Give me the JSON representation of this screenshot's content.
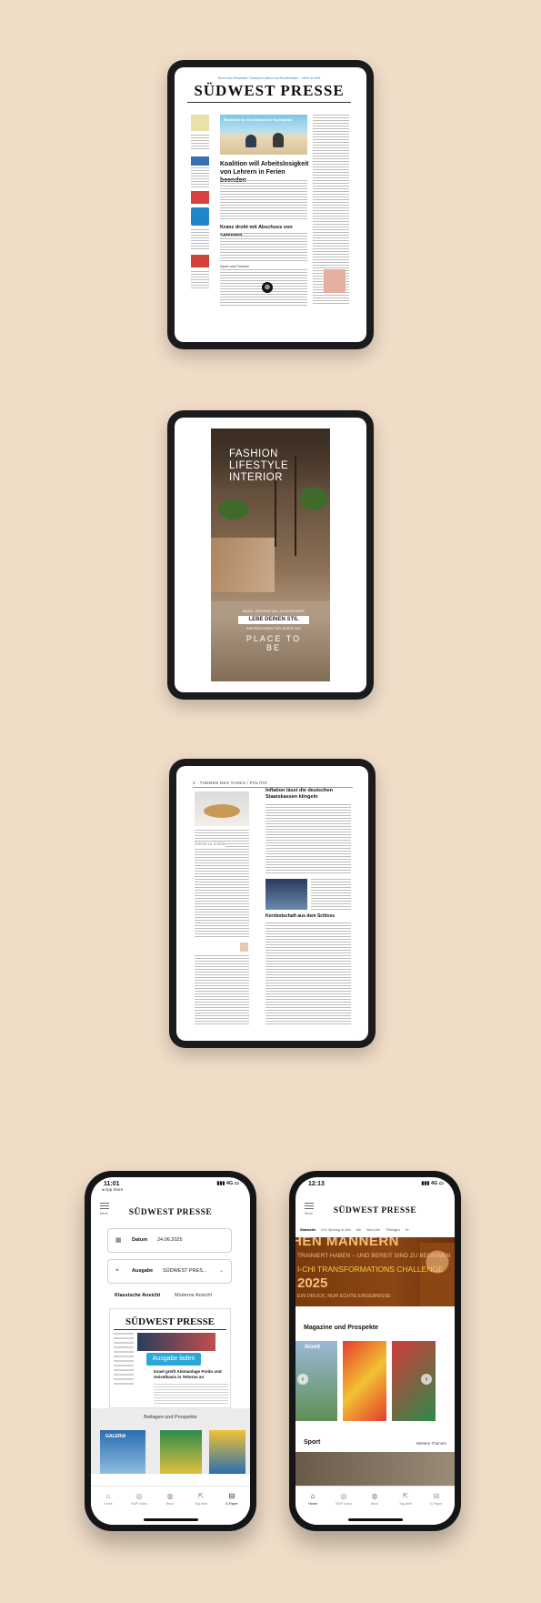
{
  "tablet1": {
    "top_line": "Rund ums Einkaufen: Gutschein-Aktion auf Sonderseiten – Mehr im Heft",
    "masthead": "SÜDWEST PRESSE",
    "photo_caption": "Rückkehr an den Strand der Normandie",
    "headline1": "Koalition will Arbeitslosigkeit von Lehrern in Ferien beenden",
    "headline2": "Kranz droht mit Abschuss von Satelliten",
    "section_label": "Sport und Freizeit"
  },
  "tablet2": {
    "title_lines": [
      "FASHION",
      "LIFESTYLE",
      "INTERIOR"
    ],
    "sub_line1": "MODE, DEKORATION, ACCESSOIRES",
    "boxed": "LEBE DEINEN STIL",
    "sub_line2": "INSPIRATIONEN FÜR JEDEN TAG",
    "place": "PLACE TO BE"
  },
  "tablet3": {
    "header": "2 · THEMEN DES TAGES / POLITIK",
    "headline1": "Inflation lässt die deutschen Staatskassen klingeln",
    "headline2": "Kernbotschaft aus dem Schloss",
    "left_head": "Schritt zu Schritt"
  },
  "phone1": {
    "status": {
      "time": "11:01",
      "back": "◂ App Store",
      "signal": "4G"
    },
    "menu_label": "Menü",
    "masthead": "SÜDWEST PRESSE",
    "date_label": "Datum",
    "date_value": "24.06.2025",
    "edition_label": "Ausgabe",
    "edition_value": "SÜDWEST PRES...",
    "view_classic": "Klassische Ansicht",
    "view_modern": "Moderne Ansicht",
    "thumb_masthead": "SÜDWEST PRESSE",
    "load_button": "Ausgabe laden",
    "thumb_headline": "Israel greift Atomanlage Fordo und Geiselbasis in Teheran an",
    "supplements_title": "Beilagen und Prospekte",
    "supplement1": "GALERIA",
    "tabs": [
      "Home",
      "SWP Video",
      "Neue",
      "Tag-Welt",
      "E-Paper"
    ]
  },
  "phone2": {
    "status": {
      "time": "12:13",
      "signal": "4G"
    },
    "menu_label": "Menü",
    "masthead": "SÜDWEST PRESSE",
    "categories": [
      "Startseite",
      "ICU Sprzing in Ulm",
      "Alb",
      "Neu-Ulm",
      "Tübingen",
      "Kr"
    ],
    "banner": {
      "line1": "HEN MÄNNERN",
      "line2": "TRAINIERT HABEN – UND BEREIT SIND ZU BEGINNEN",
      "line3": "I-CHI TRANSFORMATIONS CHALLENGE",
      "year": "2025",
      "line5": "EIN DRUCK, NUR ECHTE ERGEBNISSE"
    },
    "magazines_title": "Magazine und Prospekte",
    "mag1": "ibizelt",
    "sport_title": "Sport",
    "more_topics": "Weitere Themen",
    "tabs": [
      "Home",
      "SWP Video",
      "Neue",
      "Tag-Welt",
      "E-Paper"
    ]
  }
}
